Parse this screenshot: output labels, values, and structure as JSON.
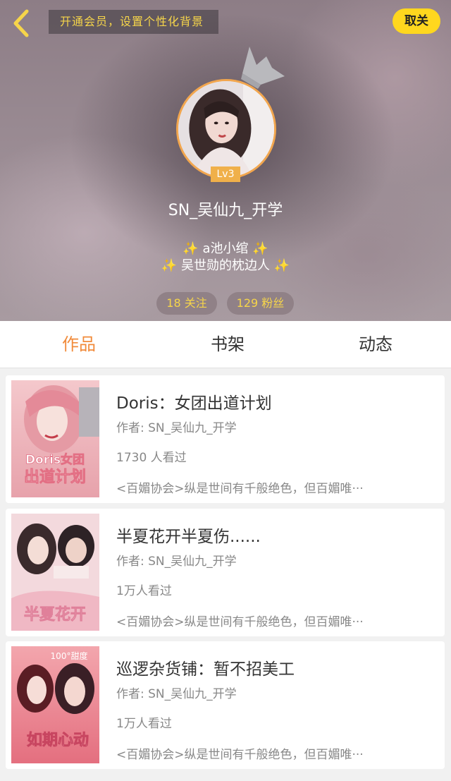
{
  "header": {
    "vip_banner": "开通会员，设置个性化背景",
    "unfollow_label": "取关",
    "level": "Lv3",
    "username": "SN_吴仙九_开学",
    "bio_line1": "a池小绾",
    "bio_line2": "吴世勋的枕边人",
    "sparkle": "✨",
    "following": "18 关注",
    "fans": "129 粉丝"
  },
  "tabs": [
    {
      "label": "作品",
      "active": true
    },
    {
      "label": "书架",
      "active": false
    },
    {
      "label": "动态",
      "active": false
    }
  ],
  "books": [
    {
      "title": "Doris：女团出道计划",
      "author": "作者: SN_吴仙九_开学",
      "views": "1730 人看过",
      "desc": "<百媚协会>纵是世间有千般绝色，但百媚唯···",
      "cover_text_1": "Doris女团",
      "cover_text_2": "出道计划"
    },
    {
      "title": "半夏花开半夏伤......",
      "author": "作者: SN_吴仙九_开学",
      "views": "1万人看过",
      "desc": "<百媚协会>纵是世间有千般绝色，但百媚唯···",
      "cover_text_1": "半夏花开"
    },
    {
      "title": "巡逻杂货铺：暂不招美工",
      "author": "作者: SN_吴仙九_开学",
      "views": "1万人看过",
      "desc": "<百媚协会>纵是世间有千般绝色，但百媚唯···",
      "cover_text_1": "100°甜度",
      "cover_text_2": "如期心动"
    }
  ],
  "colors": {
    "accent": "#f18b3b",
    "button_yellow": "#ffd71e",
    "pill_text": "#f6d54a"
  },
  "icons": [
    "back-arrow-icon",
    "crown-icon"
  ]
}
